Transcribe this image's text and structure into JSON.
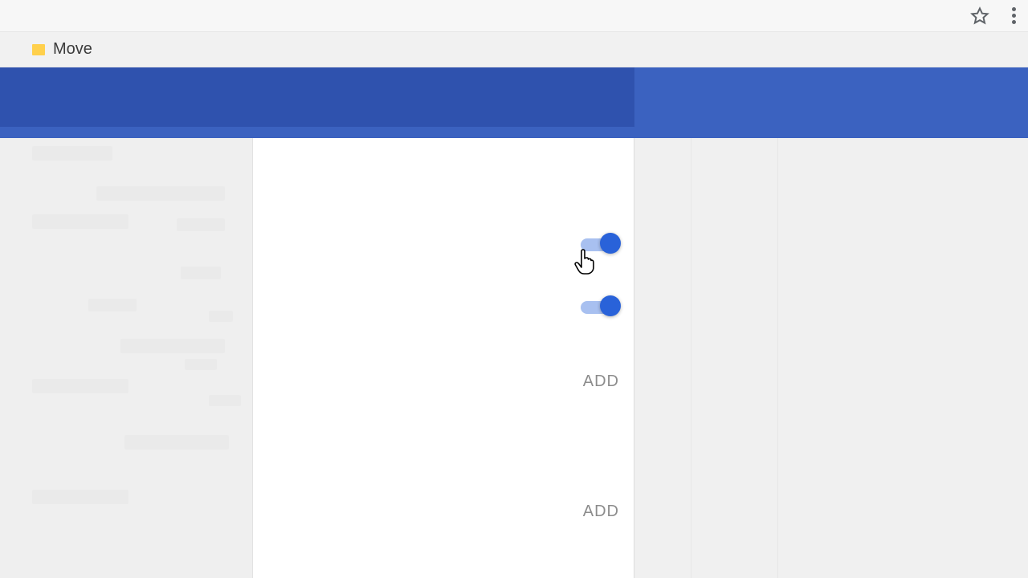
{
  "browser": {
    "bookmark_label": "Move"
  },
  "settings": {
    "toggle1": {
      "on": true
    },
    "toggle2": {
      "on": true
    },
    "add1": "ADD",
    "add2": "ADD"
  }
}
